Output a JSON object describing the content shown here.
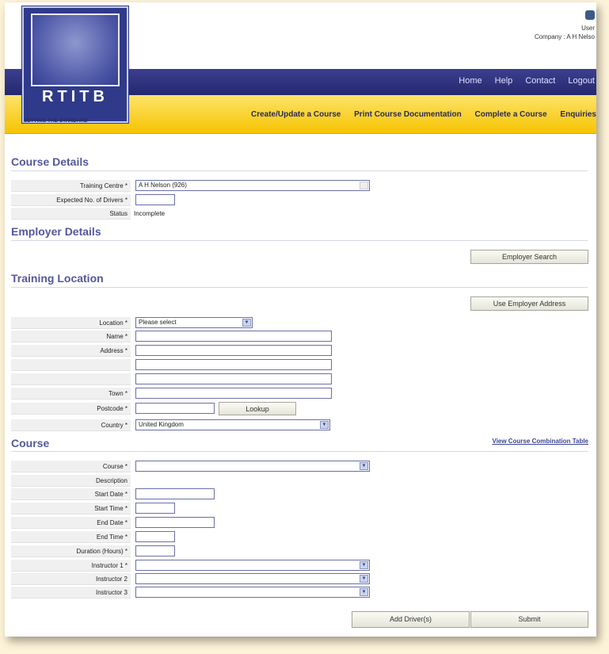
{
  "header": {
    "brand": "RTITB",
    "tagline": "SETTING THE STANDARD",
    "user_label": "User",
    "company": "Company : A H Nelso",
    "top_links": [
      "Home",
      "Help",
      "Contact",
      "Logout"
    ],
    "main_nav": [
      "Create/Update a Course",
      "Print Course Documentation",
      "Complete a Course",
      "Enquiries"
    ]
  },
  "course_details": {
    "title": "Course Details",
    "training_centre_label": "Training Centre *",
    "training_centre_value": "A H Nelson (926)",
    "expected_drivers_label": "Expected No. of Drivers *",
    "expected_drivers_value": "",
    "status_label": "Status",
    "status_value": "Incomplete"
  },
  "employer_details": {
    "title": "Employer Details",
    "search_button": "Employer Search"
  },
  "training_location": {
    "title": "Training Location",
    "use_employer_button": "Use Employer Address",
    "location_label": "Location *",
    "location_value": "Please select",
    "name_label": "Name *",
    "address_label": "Address *",
    "town_label": "Town *",
    "postcode_label": "Postcode *",
    "lookup_button": "Lookup",
    "country_label": "Country *",
    "country_value": "United Kingdom"
  },
  "course": {
    "title": "Course",
    "combination_link": "View Course Combination Table",
    "course_label": "Course *",
    "description_label": "Description",
    "start_date_label": "Start Date *",
    "start_time_label": "Start Time *",
    "end_date_label": "End Date *",
    "end_time_label": "End Time *",
    "duration_label": "Duration (Hours) *",
    "instructor1_label": "Instructor 1 *",
    "instructor2_label": "Instructor 2",
    "instructor3_label": "Instructor 3"
  },
  "actions": {
    "add_drivers": "Add Driver(s)",
    "submit": "Submit"
  }
}
